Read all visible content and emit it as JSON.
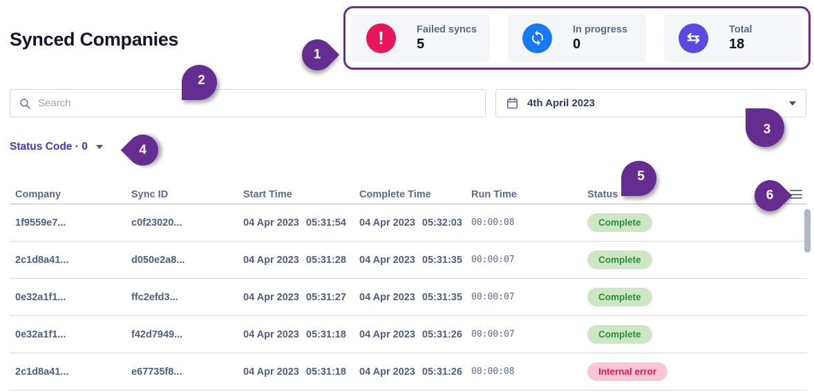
{
  "page": {
    "title": "Synced Companies"
  },
  "stats": {
    "cards": [
      {
        "label": "Failed syncs",
        "value": "5",
        "icon": "alert-icon",
        "color": "#e8175d"
      },
      {
        "label": "In progress",
        "value": "0",
        "icon": "sync-icon",
        "color": "#1678f2"
      },
      {
        "label": "Total",
        "value": "18",
        "icon": "transfer-icon",
        "color": "#5c49e0"
      }
    ]
  },
  "search": {
    "placeholder": "Search"
  },
  "date_filter": {
    "value": "4th April 2023"
  },
  "status_filter": {
    "label": "Status Code",
    "separator": "·",
    "count": "0"
  },
  "table": {
    "columns": [
      "Company",
      "Sync ID",
      "Start Time",
      "Complete Time",
      "Run Time",
      "Status"
    ],
    "rows": [
      {
        "company": "1f9559e7...",
        "sync_id": "c0f23020...",
        "start_date": "04 Apr 2023",
        "start_time": "05:31:54",
        "complete_date": "04 Apr 2023",
        "complete_time": "05:32:03",
        "run_time": "00:00:08",
        "status": "Complete",
        "status_type": "success"
      },
      {
        "company": "2c1d8a41...",
        "sync_id": "d050e2a8...",
        "start_date": "04 Apr 2023",
        "start_time": "05:31:28",
        "complete_date": "04 Apr 2023",
        "complete_time": "05:31:35",
        "run_time": "00:00:07",
        "status": "Complete",
        "status_type": "success"
      },
      {
        "company": "0e32a1f1...",
        "sync_id": "ffc2efd3...",
        "start_date": "04 Apr 2023",
        "start_time": "05:31:27",
        "complete_date": "04 Apr 2023",
        "complete_time": "05:31:35",
        "run_time": "00:00:07",
        "status": "Complete",
        "status_type": "success"
      },
      {
        "company": "0e32a1f1...",
        "sync_id": "f42d7949...",
        "start_date": "04 Apr 2023",
        "start_time": "05:31:18",
        "complete_date": "04 Apr 2023",
        "complete_time": "05:31:26",
        "run_time": "00:00:07",
        "status": "Complete",
        "status_type": "success"
      },
      {
        "company": "2c1d8a41...",
        "sync_id": "e67735f8...",
        "start_date": "04 Apr 2023",
        "start_time": "05:31:18",
        "complete_date": "04 Apr 2023",
        "complete_time": "05:31:26",
        "run_time": "00:00:08",
        "status": "Internal error",
        "status_type": "error"
      }
    ]
  },
  "annotations": {
    "markers": [
      "1",
      "2",
      "3",
      "4",
      "5",
      "6"
    ]
  },
  "colors": {
    "annotation_purple": "#662d91",
    "failed_red": "#e8175d",
    "progress_blue": "#1678f2",
    "total_indigo": "#5c49e0",
    "badge_success_bg": "#cde7c5",
    "badge_success_text": "#2e8b3a",
    "badge_error_bg": "#f9c7d3",
    "badge_error_text": "#e8175d",
    "filter_link": "#4433d0"
  }
}
